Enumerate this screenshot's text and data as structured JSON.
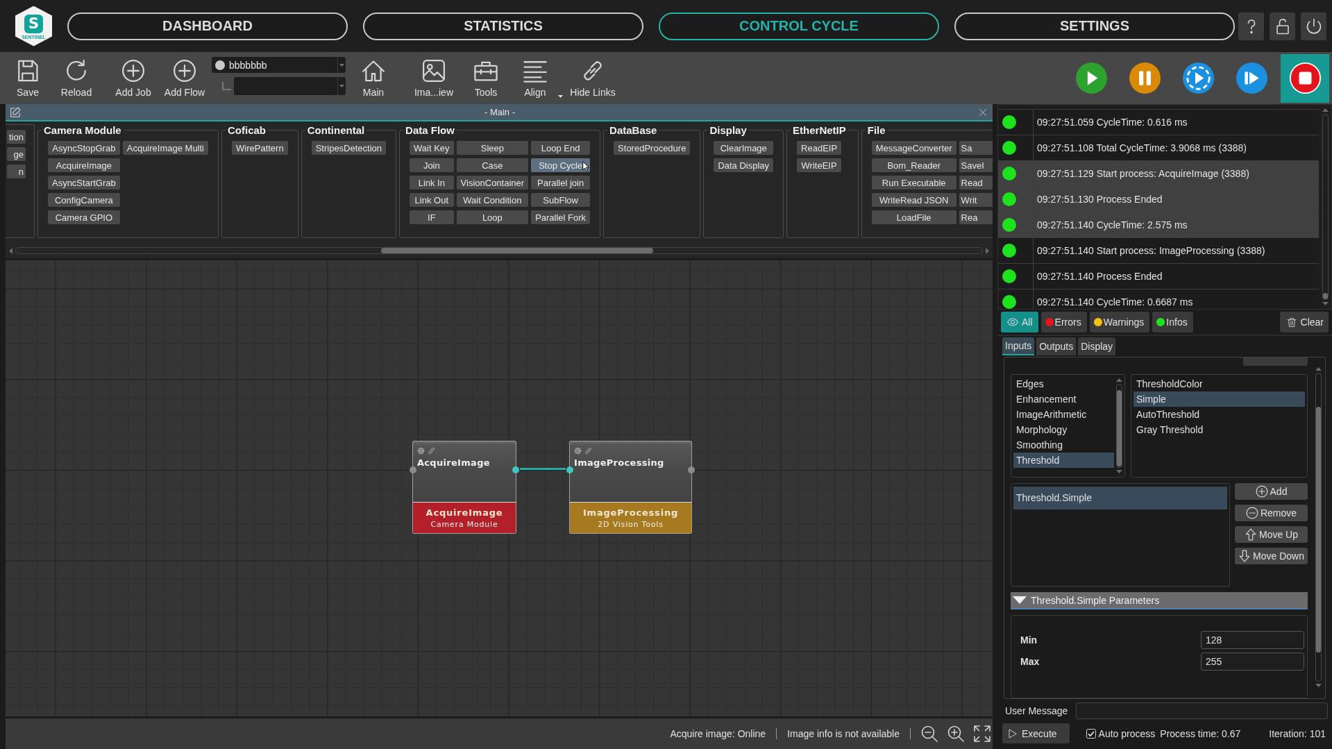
{
  "logo": {
    "letter": "S",
    "caption": "SENTINEL"
  },
  "nav": [
    {
      "label": "DASHBOARD",
      "selected": false
    },
    {
      "label": "STATISTICS",
      "selected": false
    },
    {
      "label": "CONTROL CYCLE",
      "selected": true
    },
    {
      "label": "SETTINGS",
      "selected": false
    }
  ],
  "header_buttons": [
    {
      "kind": "help"
    },
    {
      "kind": "lock"
    },
    {
      "kind": "power"
    }
  ],
  "toolbar": {
    "left": [
      {
        "kind": "save",
        "label": "Save"
      },
      {
        "kind": "reload",
        "label": "Reload"
      },
      {
        "kind": "add",
        "label": "Add Job"
      },
      {
        "kind": "add",
        "label": "Add Flow"
      }
    ],
    "job_select": {
      "value": "bbbbbbb"
    },
    "right": [
      {
        "kind": "home",
        "label": "Main",
        "dropdown": false
      },
      {
        "kind": "image",
        "label": "Ima...iew",
        "dropdown": false
      },
      {
        "kind": "toolbox",
        "label": "Tools",
        "dropdown": false
      },
      {
        "kind": "align",
        "label": "Align",
        "dropdown": true
      },
      {
        "kind": "link",
        "label": "Hide Links",
        "dropdown": false
      }
    ],
    "run_controls": [
      {
        "kind": "play",
        "selected": false
      },
      {
        "kind": "pause",
        "selected": false
      },
      {
        "kind": "cycle",
        "selected": false
      },
      {
        "kind": "step",
        "selected": false
      },
      {
        "kind": "stop",
        "selected": true
      }
    ]
  },
  "editor": {
    "title": "- Main -",
    "palette": [
      {
        "columns": [
          [
            {
              "label": "tion",
              "hovered": false
            },
            {
              "label": "ge",
              "hovered": false
            },
            {
              "label": "n",
              "hovered": false
            }
          ]
        ]
      },
      {
        "title": "Camera Module",
        "columns": [
          [
            {
              "label": "AsyncStopGrab",
              "hovered": false
            },
            {
              "label": "AcquireImage",
              "hovered": false
            },
            {
              "label": "AsyncStartGrab",
              "hovered": false
            },
            {
              "label": "ConfigCamera",
              "hovered": false
            },
            {
              "label": "Camera GPIO",
              "hovered": false
            }
          ],
          [
            {
              "label": "AcquireImage Multi",
              "hovered": false
            }
          ]
        ]
      },
      {
        "title": "Coficab",
        "columns": [
          [
            {
              "label": "WirePattern",
              "hovered": false
            }
          ]
        ]
      },
      {
        "title": "Continental",
        "columns": [
          [
            {
              "label": "StripesDetection",
              "hovered": false
            }
          ]
        ]
      },
      {
        "title": "Data Flow",
        "columns": [
          [
            {
              "label": "Wait Key",
              "hovered": false
            },
            {
              "label": "Join",
              "hovered": false
            },
            {
              "label": "Link In",
              "hovered": false
            },
            {
              "label": "Link Out",
              "hovered": false
            },
            {
              "label": "IF",
              "hovered": false
            }
          ],
          [
            {
              "label": "Sleep",
              "hovered": false
            },
            {
              "label": "Case",
              "hovered": false
            },
            {
              "label": "VisionContainer",
              "hovered": false
            },
            {
              "label": "Wait Condition",
              "hovered": false
            },
            {
              "label": "Loop",
              "hovered": false
            }
          ],
          [
            {
              "label": "Loop End",
              "hovered": false
            },
            {
              "label": "Stop Cycle",
              "hovered": true
            },
            {
              "label": "Parallel join",
              "hovered": false
            },
            {
              "label": "SubFlow",
              "hovered": false
            },
            {
              "label": "Parallel Fork",
              "hovered": false
            }
          ]
        ]
      },
      {
        "title": "DataBase",
        "columns": [
          [
            {
              "label": "StoredProcedure",
              "hovered": false
            }
          ]
        ]
      },
      {
        "title": "Display",
        "columns": [
          [
            {
              "label": "ClearImage",
              "hovered": false
            },
            {
              "label": "Data Display",
              "hovered": false
            }
          ]
        ]
      },
      {
        "title": "EtherNetIP",
        "columns": [
          [
            {
              "label": "ReadEIP",
              "hovered": false
            },
            {
              "label": "WriteEIP",
              "hovered": false
            }
          ]
        ]
      },
      {
        "title": "File",
        "columns": [
          [
            {
              "label": "MessageConverter",
              "hovered": false
            },
            {
              "label": "Bom_Reader",
              "hovered": false
            },
            {
              "label": "Run Executable",
              "hovered": false
            },
            {
              "label": "WriteRead JSON",
              "hovered": false
            },
            {
              "label": "LoadFile",
              "hovered": false
            }
          ],
          [
            {
              "label": "Sa",
              "hovered": false
            },
            {
              "label": "SaveI",
              "hovered": false
            },
            {
              "label": "Read",
              "hovered": false
            },
            {
              "label": "Writ",
              "hovered": false
            },
            {
              "label": "Rea",
              "hovered": false
            }
          ]
        ]
      }
    ],
    "nodes": [
      {
        "title": "AcquireImage",
        "label": "AcquireImage",
        "category": "Camera Module",
        "color": "#b3202a",
        "input_linked": false,
        "output_linked": true
      },
      {
        "title": "ImageProcessing",
        "label": "ImageProcessing",
        "category": "2D Vision Tools",
        "color": "#a87a20",
        "input_linked": true,
        "output_linked": false
      }
    ],
    "status": [
      "Acquire image: Online",
      "Image info is not available"
    ]
  },
  "log": {
    "entries": [
      {
        "text": "09:27:51.059 CycleTime: 0.616 ms",
        "color": "#1ee21e",
        "selected": false
      },
      {
        "text": "09:27:51.108 Total CycleTime: 3.9068 ms (3388)",
        "color": "#1ee21e",
        "selected": false
      },
      {
        "text": "09:27:51.129 Start process: AcquireImage (3388)",
        "color": "#1ee21e",
        "selected": true
      },
      {
        "text": "09:27:51.130 Process Ended",
        "color": "#1ee21e",
        "selected": true
      },
      {
        "text": "09:27:51.140 CycleTime: 2.575 ms",
        "color": "#1ee21e",
        "selected": true
      },
      {
        "text": "09:27:51.140 Start process: ImageProcessing (3388)",
        "color": "#1ee21e",
        "selected": false
      },
      {
        "text": "09:27:51.140 Process Ended",
        "color": "#1ee21e",
        "selected": false
      },
      {
        "text": "09:27:51.140 CycleTime: 0.6687 ms",
        "color": "#1ee21e",
        "selected": false
      }
    ],
    "filters": [
      {
        "kind": "all",
        "label": "All",
        "selected": true
      },
      {
        "kind": "level",
        "label": "Errors",
        "color": "#e8141c",
        "selected": false
      },
      {
        "kind": "level",
        "label": "Warnings",
        "color": "#f2c21b",
        "selected": false
      },
      {
        "kind": "level",
        "label": "Infos",
        "color": "#1ee21e",
        "selected": false
      }
    ],
    "clear": "Clear"
  },
  "inspector": {
    "tabs": [
      {
        "label": "Inputs",
        "selected": true
      },
      {
        "label": "Outputs",
        "selected": false
      },
      {
        "label": "Display",
        "selected": false
      }
    ],
    "categories": [
      {
        "label": "Edges",
        "selected": false
      },
      {
        "label": "Enhancement",
        "selected": false
      },
      {
        "label": "ImageArithmetic",
        "selected": false
      },
      {
        "label": "Morphology",
        "selected": false
      },
      {
        "label": "Smoothing",
        "selected": false
      },
      {
        "label": "Threshold",
        "selected": true
      }
    ],
    "operations": [
      {
        "label": "ThresholdColor",
        "selected": false
      },
      {
        "label": "Simple",
        "selected": true
      },
      {
        "label": "AutoThreshold",
        "selected": false
      },
      {
        "label": "Gray Threshold",
        "selected": false
      }
    ],
    "steps": [
      {
        "label": "Threshold.Simple",
        "selected": true
      }
    ],
    "actions": [
      {
        "kind": "add",
        "label": "Add"
      },
      {
        "kind": "remove",
        "label": "Remove"
      },
      {
        "kind": "up",
        "label": "Move Up"
      },
      {
        "kind": "down",
        "label": "Move Down"
      }
    ],
    "parameters": {
      "title": "Threshold.Simple Parameters",
      "expanded": true,
      "fields": [
        {
          "label": "Min",
          "value": "128"
        },
        {
          "label": "Max",
          "value": "255"
        }
      ]
    },
    "user_message": {
      "label": "User Message"
    },
    "execute": "Execute",
    "auto_process": {
      "label": "Auto process",
      "checked": true
    },
    "process_time": "Process time: 0.67",
    "iteration": "Iteration: 101"
  }
}
